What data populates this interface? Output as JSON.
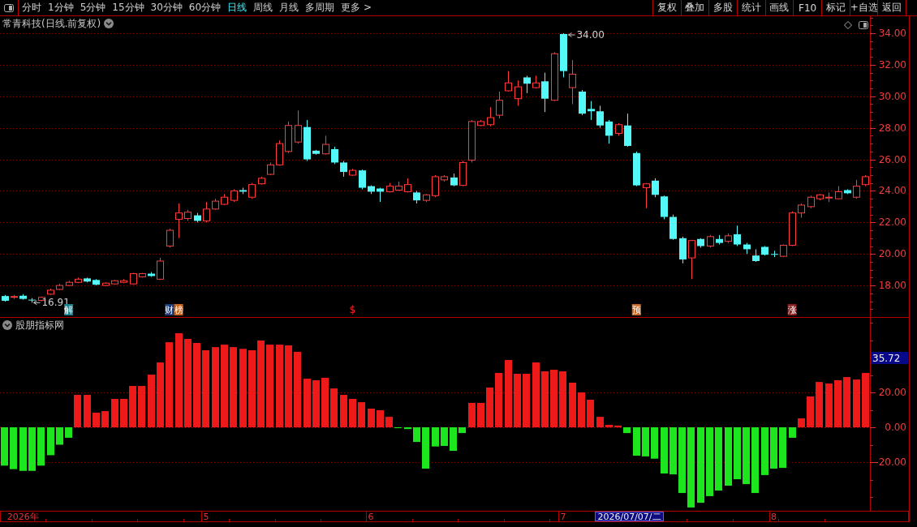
{
  "toolbar": {
    "periods": [
      {
        "label": "分时",
        "selected": false
      },
      {
        "label": "1分钟",
        "selected": false
      },
      {
        "label": "5分钟",
        "selected": false
      },
      {
        "label": "15分钟",
        "selected": false
      },
      {
        "label": "30分钟",
        "selected": false
      },
      {
        "label": "60分钟",
        "selected": false
      },
      {
        "label": "日线",
        "selected": true
      },
      {
        "label": "周线",
        "selected": false
      },
      {
        "label": "月线",
        "selected": false
      },
      {
        "label": "多周期",
        "selected": false
      },
      {
        "label": "更多 >",
        "selected": false
      }
    ],
    "actions": [
      "复权",
      "叠加",
      "多股",
      "统计",
      "画线",
      "F10",
      "标记",
      "+自选",
      "返回"
    ]
  },
  "price_pane": {
    "title": "常青科技(日线.前复权)",
    "chart_data": [
      {
        "type": "candlestick",
        "ylim": [
          16,
          35.08
        ],
        "yticks": [
          {
            "value": 18,
            "label": "18.00"
          },
          {
            "value": 20,
            "label": "20.00"
          },
          {
            "value": 22,
            "label": "22.00"
          },
          {
            "value": 24,
            "label": "24.00"
          },
          {
            "value": 26,
            "label": "26.00"
          },
          {
            "value": 28,
            "label": "28.00"
          },
          {
            "value": 30,
            "label": "30.00"
          },
          {
            "value": 32,
            "label": "32.00"
          },
          {
            "value": 34,
            "label": "34.00"
          }
        ],
        "grid": true,
        "annotations": [
          "34.00",
          "16.91"
        ],
        "categories": [
          null,
          null,
          null,
          null,
          null,
          null,
          null,
          "解",
          null,
          null,
          null,
          null,
          null,
          null,
          null,
          null,
          null,
          null,
          "财",
          "榜",
          null,
          null,
          null,
          null,
          null,
          null,
          null,
          null,
          null,
          null,
          null,
          null,
          null,
          null,
          null,
          null,
          null,
          null,
          "$",
          null,
          null,
          null,
          null,
          null,
          null,
          null,
          null,
          null,
          null,
          null,
          null,
          null,
          null,
          null,
          null,
          null,
          null,
          null,
          null,
          null,
          null,
          null,
          null,
          null,
          null,
          null,
          null,
          null,
          null,
          "预",
          null,
          null,
          null,
          null,
          null,
          null,
          null,
          null,
          null,
          null,
          null,
          null,
          null,
          null,
          null,
          null,
          "涨",
          null,
          null,
          null,
          null,
          null,
          null,
          null,
          null
        ],
        "ohlc": [
          [
            17.33,
            17.4,
            16.98,
            17.03
          ],
          [
            17.25,
            17.4,
            17.15,
            17.3
          ],
          [
            17.35,
            17.45,
            17.1,
            17.15
          ],
          [
            17.1,
            17.2,
            16.91,
            17.05
          ],
          [
            17.05,
            17.3,
            17.0,
            17.25
          ],
          [
            17.45,
            17.8,
            17.4,
            17.7
          ],
          [
            17.75,
            18.1,
            17.7,
            18.0
          ],
          [
            18.0,
            18.3,
            17.95,
            18.2
          ],
          [
            18.2,
            18.5,
            18.15,
            18.4
          ],
          [
            18.45,
            18.5,
            18.2,
            18.25
          ],
          [
            18.35,
            18.4,
            18.0,
            18.05
          ],
          [
            18.0,
            18.2,
            17.95,
            18.15
          ],
          [
            18.1,
            18.35,
            18.05,
            18.3
          ],
          [
            18.2,
            18.4,
            18.15,
            18.3
          ],
          [
            18.1,
            18.8,
            18.05,
            18.75
          ],
          [
            18.55,
            18.8,
            18.5,
            18.75
          ],
          [
            18.75,
            18.85,
            18.55,
            18.6
          ],
          [
            18.4,
            19.75,
            18.35,
            19.55
          ],
          [
            20.5,
            21.6,
            20.4,
            21.5
          ],
          [
            22.2,
            23.2,
            21.0,
            22.6
          ],
          [
            22.25,
            22.8,
            22.1,
            22.65
          ],
          [
            22.45,
            22.6,
            22.0,
            22.1
          ],
          [
            22.1,
            23.3,
            22.0,
            22.85
          ],
          [
            22.85,
            23.5,
            22.8,
            23.35
          ],
          [
            23.15,
            23.8,
            23.1,
            23.6
          ],
          [
            23.4,
            24.1,
            23.3,
            24.0
          ],
          [
            24.05,
            24.2,
            23.8,
            23.95
          ],
          [
            23.6,
            24.5,
            23.5,
            24.4
          ],
          [
            24.45,
            24.9,
            24.4,
            24.8
          ],
          [
            25.05,
            25.8,
            25.0,
            25.65
          ],
          [
            25.65,
            27.2,
            25.6,
            27.0
          ],
          [
            26.5,
            28.4,
            26.4,
            28.15
          ],
          [
            27.1,
            29.1,
            27.0,
            28.15
          ],
          [
            28.05,
            28.5,
            25.9,
            26.0
          ],
          [
            26.55,
            26.6,
            26.3,
            26.35
          ],
          [
            26.35,
            27.5,
            26.3,
            26.95
          ],
          [
            26.65,
            26.8,
            25.7,
            25.8
          ],
          [
            25.8,
            25.9,
            24.9,
            25.2
          ],
          [
            25.0,
            25.4,
            24.95,
            25.3
          ],
          [
            25.3,
            25.35,
            24.1,
            24.2
          ],
          [
            24.3,
            24.35,
            23.8,
            23.95
          ],
          [
            24.15,
            24.2,
            23.3,
            23.95
          ],
          [
            23.95,
            24.5,
            23.9,
            24.3
          ],
          [
            24.05,
            24.6,
            24.0,
            24.3
          ],
          [
            23.95,
            24.8,
            23.9,
            24.4
          ],
          [
            23.9,
            24.0,
            23.2,
            23.4
          ],
          [
            23.4,
            23.8,
            23.3,
            23.75
          ],
          [
            23.7,
            25.0,
            23.6,
            24.9
          ],
          [
            24.7,
            25.0,
            24.6,
            24.9
          ],
          [
            24.85,
            25.1,
            24.3,
            24.35
          ],
          [
            24.35,
            25.9,
            24.3,
            25.8
          ],
          [
            25.95,
            28.5,
            25.8,
            28.4
          ],
          [
            28.15,
            28.5,
            28.1,
            28.4
          ],
          [
            28.2,
            29.3,
            28.1,
            28.65
          ],
          [
            28.8,
            30.3,
            28.6,
            29.75
          ],
          [
            30.35,
            31.6,
            30.3,
            30.85
          ],
          [
            29.85,
            31.0,
            29.4,
            30.6
          ],
          [
            31.2,
            31.3,
            30.2,
            30.8
          ],
          [
            30.55,
            31.3,
            30.5,
            30.85
          ],
          [
            30.95,
            31.5,
            29.0,
            29.85
          ],
          [
            29.75,
            32.8,
            29.7,
            32.7
          ],
          [
            33.95,
            34.0,
            31.2,
            31.6
          ],
          [
            30.55,
            32.3,
            29.5,
            31.4
          ],
          [
            30.3,
            30.4,
            28.8,
            28.9
          ],
          [
            29.2,
            29.7,
            28.5,
            29.05
          ],
          [
            29.05,
            29.4,
            28.0,
            28.15
          ],
          [
            28.4,
            28.5,
            27.0,
            27.5
          ],
          [
            27.65,
            28.3,
            27.5,
            28.2
          ],
          [
            28.15,
            28.9,
            26.8,
            26.85
          ],
          [
            26.4,
            26.5,
            24.3,
            24.35
          ],
          [
            24.2,
            24.5,
            22.9,
            24.45
          ],
          [
            24.65,
            24.8,
            23.6,
            23.75
          ],
          [
            23.65,
            23.7,
            22.2,
            22.35
          ],
          [
            22.35,
            22.5,
            20.9,
            20.95
          ],
          [
            21.0,
            21.1,
            19.4,
            19.65
          ],
          [
            19.75,
            20.9,
            18.4,
            20.85
          ],
          [
            20.95,
            21.0,
            20.4,
            20.5
          ],
          [
            20.5,
            21.2,
            20.4,
            21.1
          ],
          [
            20.95,
            21.2,
            20.6,
            20.7
          ],
          [
            20.8,
            21.3,
            20.7,
            21.15
          ],
          [
            21.25,
            21.8,
            20.5,
            20.6
          ],
          [
            20.6,
            20.7,
            20.0,
            20.3
          ],
          [
            19.9,
            20.3,
            19.5,
            19.55
          ],
          [
            20.45,
            20.5,
            19.9,
            19.95
          ],
          [
            20.0,
            20.2,
            19.8,
            19.95
          ],
          [
            19.85,
            20.6,
            19.8,
            20.55
          ],
          [
            20.55,
            22.7,
            20.5,
            22.6
          ],
          [
            22.6,
            23.2,
            22.3,
            23.1
          ],
          [
            23.0,
            23.7,
            22.9,
            23.6
          ],
          [
            23.5,
            23.8,
            23.4,
            23.75
          ],
          [
            23.55,
            23.9,
            23.3,
            23.6
          ],
          [
            23.5,
            24.3,
            23.45,
            23.95
          ],
          [
            24.05,
            24.1,
            23.8,
            23.85
          ],
          [
            23.6,
            24.7,
            23.5,
            24.3
          ],
          [
            24.4,
            25.0,
            24.3,
            24.9
          ]
        ]
      }
    ],
    "event_tags": [
      {
        "kind": "tag",
        "color": "#1e7f8c"
      },
      {
        "kind": "tag",
        "color": "#203c78"
      },
      {
        "kind": "tag",
        "color": "#c8641e"
      },
      {
        "kind": "text",
        "color": "#ff2020"
      },
      {
        "kind": "tag",
        "color": "#c8641e"
      },
      {
        "kind": "tag",
        "color": "#8c1c1c"
      }
    ]
  },
  "indicator_pane": {
    "title": "股朋指标网",
    "chart_data": [
      {
        "type": "bar",
        "ylim": [
          -47.9,
          62.8
        ],
        "yticks": [
          {
            "value": -20,
            "label": "-20.00"
          },
          {
            "value": 0,
            "label": "0.00"
          },
          {
            "value": 20,
            "label": "20.00"
          }
        ],
        "grid": true,
        "annotations": [
          "35.72",
          "2026/07/07/二"
        ],
        "categories": [
          null,
          null,
          "2026年",
          null,
          null,
          null,
          null,
          null,
          null,
          null,
          null,
          null,
          null,
          null,
          null,
          null,
          null,
          null,
          null,
          null,
          null,
          null,
          "5",
          null,
          null,
          null,
          null,
          null,
          null,
          null,
          null,
          null,
          null,
          null,
          null,
          null,
          null,
          null,
          null,
          null,
          "6",
          null,
          null,
          null,
          null,
          null,
          null,
          null,
          null,
          null,
          null,
          null,
          null,
          null,
          null,
          null,
          null,
          null,
          null,
          null,
          null,
          "7",
          null,
          null,
          null,
          null,
          null,
          null,
          null,
          null,
          null,
          null,
          null,
          null,
          null,
          null,
          null,
          null,
          null,
          null,
          null,
          null,
          null,
          null,
          "8",
          null,
          null,
          null,
          null,
          null,
          null,
          null,
          null,
          null,
          null
        ],
        "values": [
          -22,
          -24,
          -25,
          -25,
          -22,
          -16,
          -10,
          -6,
          18.6,
          18.6,
          8.4,
          9.3,
          16.3,
          16.3,
          23.7,
          23.7,
          30.2,
          37.2,
          48.8,
          54,
          50.7,
          48.4,
          44.2,
          46,
          47.4,
          46,
          45,
          44.2,
          49.8,
          47.4,
          47.4,
          47,
          43.3,
          27.9,
          27,
          28.4,
          22.3,
          18.6,
          16.3,
          14.4,
          10.7,
          9.8,
          6,
          -0.5,
          -1,
          -8.4,
          -23.7,
          -11,
          -10.7,
          -13.5,
          -3.3,
          14,
          14,
          22.8,
          31.2,
          38.6,
          30.7,
          30.7,
          37.2,
          32.1,
          33,
          32.1,
          25.6,
          20,
          15.8,
          6,
          1.4,
          1,
          -3.3,
          -16.3,
          -16.7,
          -18,
          -26.5,
          -27,
          -37.7,
          -46,
          -43.3,
          -39.5,
          -36.3,
          -33.5,
          -29.8,
          -32.6,
          -37.7,
          -27.4,
          -23.7,
          -23.3,
          -6,
          5.1,
          17.7,
          26,
          25.1,
          27,
          28.8,
          27.4,
          31.2
        ]
      }
    ]
  }
}
